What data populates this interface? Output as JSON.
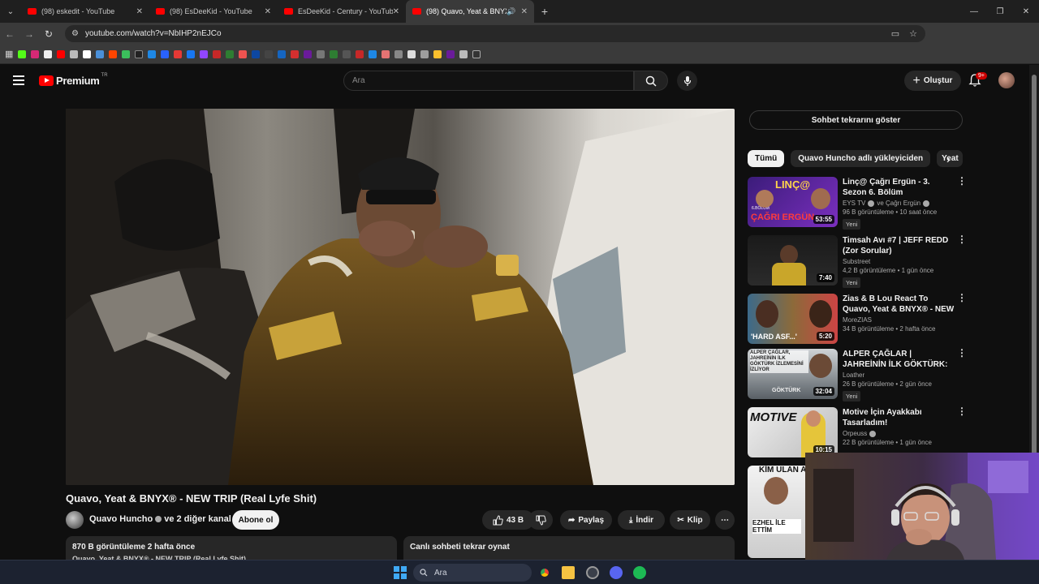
{
  "browser": {
    "tabs": [
      {
        "title": "(98) eskedit - YouTube",
        "active": false
      },
      {
        "title": "(98) EsDeeKid - YouTube",
        "active": false
      },
      {
        "title": "EsDeeKid - Century - YouTube",
        "active": false
      },
      {
        "title": "(98) Quavo, Yeat & BNYX®",
        "active": true
      }
    ],
    "url": "youtube.com/watch?v=NbIHP2nEJCo"
  },
  "header": {
    "logo_text": "Premium",
    "logo_region": "TR",
    "search_placeholder": "Ara",
    "create_label": "Oluştur",
    "notification_count": "9+"
  },
  "video": {
    "title": "Quavo, Yeat & BNYX® - NEW TRIP (Real Lyfe Shit)",
    "channel": "Quavo Huncho",
    "channel_suffix": "ve 2 diğer kanal",
    "subscribe_label": "Abone ol",
    "likes": "43 B",
    "share_label": "Paylaş",
    "download_label": "İndir",
    "clip_label": "Klip",
    "views_line": "870 B görüntüleme  2 hafta önce",
    "desc_line": "Quavo, Yeat & BNYX® - NEW TRIP (Real Lyfe Shit)",
    "replay_label": "Canlı sohbeti tekrar oynat"
  },
  "sidebar": {
    "chat_button": "Sohbet tekrarını göster",
    "chips": [
      "Tümü",
      "Quavo Huncho adlı yükleyiciden",
      "Yeat"
    ],
    "recommendations": [
      {
        "title": "Linç@ Çağrı Ergün - 3. Sezon 6. Bölüm",
        "channel": "EYS TV",
        "channel_extra": "ve Çağrı Ergün",
        "meta": "96 B görüntüleme • 10 saat önce",
        "duration": "53:55",
        "badge": "Yeni",
        "thumb_text": "LINÇ@",
        "thumb_sub": "ÇAĞRI ERGÜN",
        "thumb_top": "6.BÖLÜM"
      },
      {
        "title": "Timsah Avı #7 | JEFF REDD (Zor Sorular)",
        "channel": "Substreet",
        "meta": "4,2 B görüntüleme • 1 gün önce",
        "duration": "7:40",
        "badge": "Yeni"
      },
      {
        "title": "Zias & B Lou React To Quavo, Yeat & BNYX® - NEW TRIP (Re...",
        "channel": "MoreZIAS",
        "meta": "34 B görüntüleme • 2 hafta önce",
        "duration": "5:20",
        "thumb_text": "'HARD ASF...'"
      },
      {
        "title": "ALPER ÇAĞLAR  | JAHREİNİN İLK GÖKTÜRK: Önsöz | Teaser...",
        "channel": "Loather",
        "meta": "26 B görüntüleme • 2 gün önce",
        "duration": "32:04",
        "badge": "Yeni",
        "thumb_text": "ALPER ÇAĞLAR, JAHREİNİN İLK GÖKTÜRK İZLEMESİNİ İZLİYOR",
        "thumb_sub": "GÖKTÜRK"
      },
      {
        "title": "Motive İçin Ayakkabı Tasarladım!",
        "channel": "Orpeuss",
        "meta": "22 B görüntüleme • 1 gün önce",
        "duration": "10:15",
        "thumb_text": "MOTIVE"
      },
      {
        "thumb_text": "KİM ULAN ABİ",
        "thumb_sub": "EZHEL İLE ETTİM"
      }
    ]
  },
  "taskbar": {
    "search_label": "Ara"
  },
  "colors": {
    "background": "#0f0f0f",
    "brand_red": "#ff0000",
    "chip_bg": "#272727"
  }
}
